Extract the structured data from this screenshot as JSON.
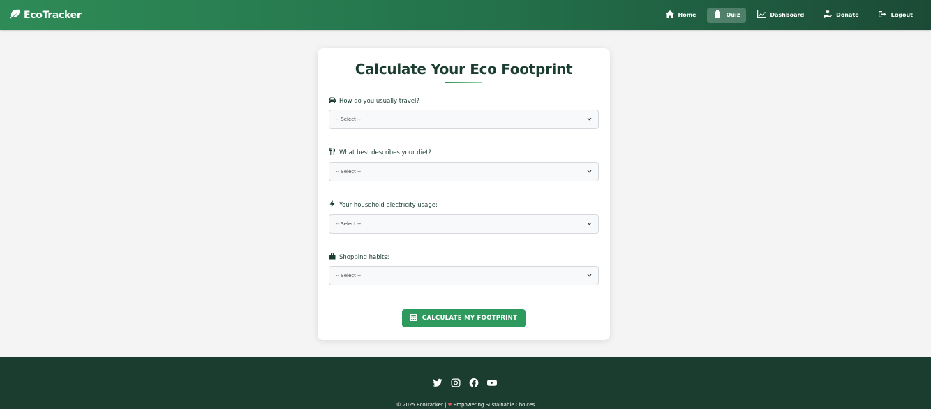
{
  "brand": {
    "name": "EcoTracker",
    "icon": "leaf-icon"
  },
  "nav": [
    {
      "label": "Home",
      "icon": "home-icon",
      "active": false
    },
    {
      "label": "Quiz",
      "icon": "clipboard-icon",
      "active": true
    },
    {
      "label": "Dashboard",
      "icon": "chart-line-icon",
      "active": false
    },
    {
      "label": "Donate",
      "icon": "hand-holding-heart-icon",
      "active": false
    },
    {
      "label": "Logout",
      "icon": "sign-out-icon",
      "active": false
    }
  ],
  "quiz": {
    "title": "Calculate Your Eco Footprint",
    "questions": [
      {
        "label": "How do you usually travel?",
        "icon": "car-icon",
        "selected": "-- Select --"
      },
      {
        "label": "What best describes your diet?",
        "icon": "utensils-icon",
        "selected": "-- Select --"
      },
      {
        "label": "Your household electricity usage:",
        "icon": "bolt-icon",
        "selected": "-- Select --"
      },
      {
        "label": "Shopping habits:",
        "icon": "shopping-bag-icon",
        "selected": "-- Select --"
      }
    ],
    "submit_label": "CALCULATE MY FOOTPRINT"
  },
  "footer": {
    "socials": [
      "twitter-icon",
      "instagram-icon",
      "facebook-icon",
      "youtube-icon"
    ],
    "copyright_prefix": "© 2025 EcoTracker |",
    "copyright_suffix": "Empowering Sustainable Choices"
  },
  "colors": {
    "primary": "#2e8b57",
    "dark": "#1b3d2f",
    "button": "#2e9a5e",
    "heart": "#e05a6b"
  }
}
